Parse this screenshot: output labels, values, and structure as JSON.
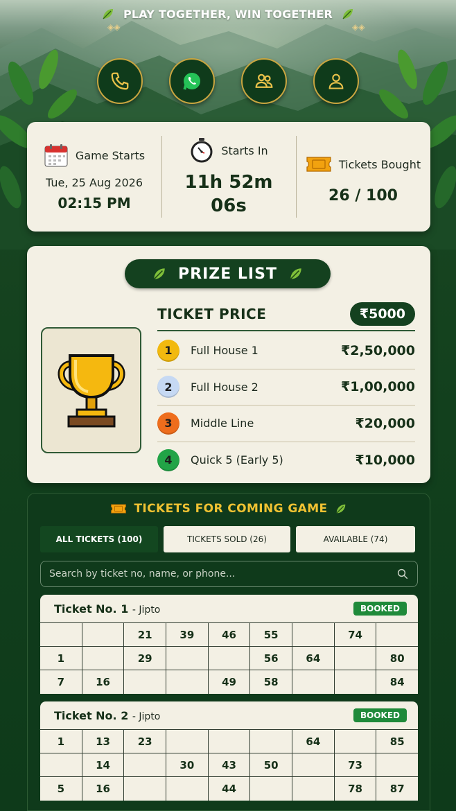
{
  "header": {
    "title": "PLAY TOGETHER, WIN TOGETHER",
    "actions": [
      {
        "name": "phone",
        "icon": "phone-icon"
      },
      {
        "name": "whatsapp",
        "icon": "whatsapp-icon"
      },
      {
        "name": "group",
        "icon": "group-icon"
      },
      {
        "name": "profile",
        "icon": "user-icon"
      }
    ]
  },
  "info": {
    "game_starts_label": "Game Starts",
    "game_date": "Tue, 25 Aug 2026",
    "game_time": "02:15 PM",
    "starts_in_label": "Starts In",
    "countdown_line1": "11h 52m",
    "countdown_line2": "06s",
    "tickets_bought_label": "Tickets Bought",
    "tickets_bought_value": "26 / 100"
  },
  "prize": {
    "title": "PRIZE LIST",
    "ticket_price_label": "TICKET PRICE",
    "ticket_price_value": "₹5000",
    "items": [
      {
        "rank": "1",
        "name": "Full House 1",
        "amount": "₹2,50,000",
        "color": "#f2b90f"
      },
      {
        "rank": "2",
        "name": "Full House 2",
        "amount": "₹1,00,000",
        "color": "#c6d9f3"
      },
      {
        "rank": "3",
        "name": "Middle Line",
        "amount": "₹20,000",
        "color": "#ee6d1c"
      },
      {
        "rank": "4",
        "name": "Quick 5 (Early 5)",
        "amount": "₹10,000",
        "color": "#22a447"
      }
    ]
  },
  "tickets": {
    "title": "TICKETS FOR COMING GAME",
    "tabs": [
      {
        "label": "ALL TICKETS (100)",
        "active": true
      },
      {
        "label": "TICKETS SOLD (26)",
        "active": false
      },
      {
        "label": "AVAILABLE (74)",
        "active": false
      }
    ],
    "search_placeholder": "Search by ticket no, name, or phone...",
    "list": [
      {
        "name": "Ticket No. 1",
        "owner": "- Jipto",
        "status": "BOOKED",
        "rows": [
          [
            "",
            "",
            "21",
            "39",
            "46",
            "55",
            "",
            "74",
            ""
          ],
          [
            "1",
            "",
            "29",
            "",
            "",
            "56",
            "64",
            "",
            "80"
          ],
          [
            "7",
            "16",
            "",
            "",
            "49",
            "58",
            "",
            "",
            "84"
          ]
        ]
      },
      {
        "name": "Ticket No. 2",
        "owner": "- Jipto",
        "status": "BOOKED",
        "rows": [
          [
            "1",
            "13",
            "23",
            "",
            "",
            "",
            "64",
            "",
            "85"
          ],
          [
            "",
            "14",
            "",
            "30",
            "43",
            "50",
            "",
            "73",
            ""
          ],
          [
            "5",
            "16",
            "",
            "",
            "44",
            "",
            "",
            "78",
            "87"
          ]
        ]
      }
    ]
  },
  "colors": {
    "dark_green": "#14411f",
    "cream": "#f3f0e4",
    "gold": "#f0c232",
    "booked_green": "#1f8a3a"
  }
}
